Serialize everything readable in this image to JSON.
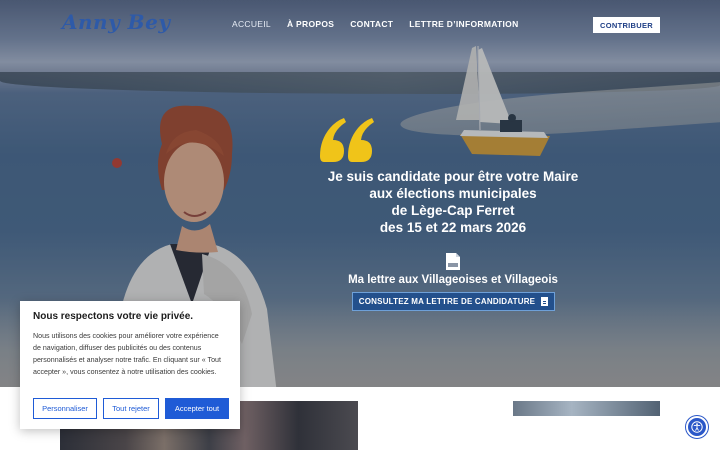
{
  "site": {
    "logo": "Anny Bey",
    "brand_color": "#2e5aa8"
  },
  "nav": {
    "items": [
      {
        "label": "ACCUEIL",
        "active": true
      },
      {
        "label": "À PROPOS",
        "active": false
      },
      {
        "label": "CONTACT",
        "active": false
      },
      {
        "label": "LETTRE D’INFORMATION",
        "active": false
      }
    ],
    "cta_label": "CONTRIBUER"
  },
  "hero": {
    "headline_lines": [
      "Je suis candidate pour être votre Maire",
      "aux élections municipales",
      "de Lège-Cap Ferret",
      "des 15 et 22 mars 2026"
    ],
    "quote_color": "#f0c419",
    "pdf_icon": "pdf-file-icon",
    "letter_title": "Ma lettre aux Villageoises et Villageois",
    "letter_button": "CONSULTEZ MA LETTRE DE CANDIDATURE",
    "letter_button_icon": "document-icon"
  },
  "cookie_banner": {
    "title": "Nous respectons votre vie privée.",
    "text": "Nous utilisons des cookies pour améliorer votre expérience de navigation, diffuser des publicités ou des contenus personnalisés et analyser notre trafic. En cliquant sur « Tout accepter », vous consentez à notre utilisation des cookies.",
    "buttons": {
      "customize": "Personnaliser",
      "reject": "Tout rejeter",
      "accept": "Accepter tout"
    },
    "accent": "#1f5bd6"
  },
  "accessibility_icon": "accessibility-icon"
}
